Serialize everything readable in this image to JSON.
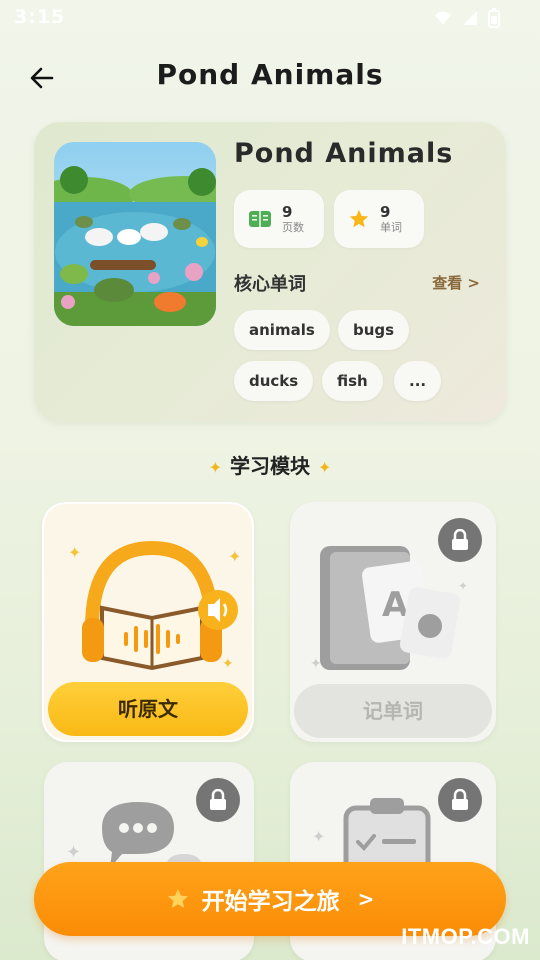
{
  "status": {
    "time": "3:15"
  },
  "header": {
    "title": "Pond  Animals"
  },
  "book": {
    "title": "Pond  Animals",
    "pages": {
      "value": "9",
      "label": "页数"
    },
    "words": {
      "value": "9",
      "label": "单词"
    },
    "core_title": "核心单词",
    "view_label": "查看 >",
    "chips": [
      "animals",
      "bugs",
      "ducks",
      "fish",
      "..."
    ]
  },
  "section": {
    "title": "学习模块"
  },
  "modules": [
    {
      "label": "听原文",
      "locked": false
    },
    {
      "label": "记单词",
      "locked": true
    },
    {
      "label": "",
      "locked": true
    },
    {
      "label": "",
      "locked": true
    }
  ],
  "start": {
    "label": "开始学习之旅",
    "arrow": ">"
  },
  "watermark": "ITMOP.COM",
  "colors": {
    "accent": "#FB8C06",
    "yellow": "#F9B915",
    "lock": "#757575",
    "link": "#8A6A3C"
  }
}
